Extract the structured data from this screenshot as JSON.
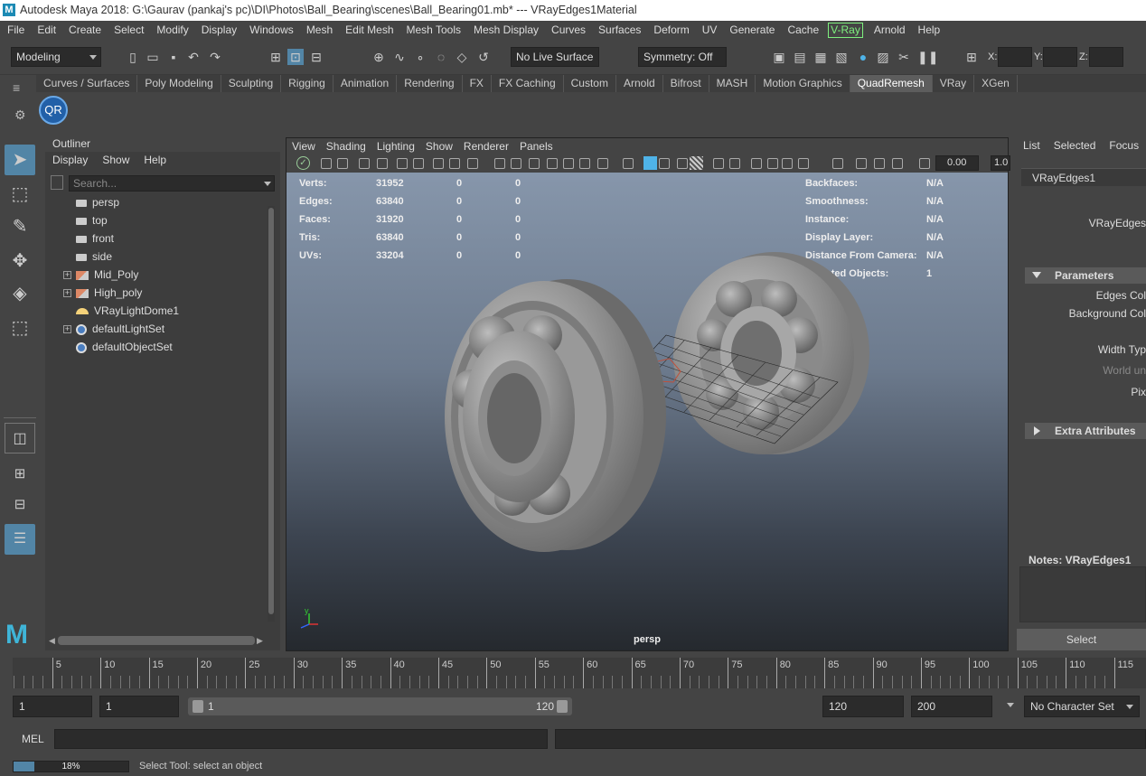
{
  "window": {
    "title": "Autodesk Maya 2018: G:\\Gaurav (pankaj's pc)\\DI\\Photos\\Ball_Bearing\\scenes\\Ball_Bearing01.mb*   ---   VRayEdges1Material",
    "logo": "M"
  },
  "menubar": [
    "File",
    "Edit",
    "Create",
    "Select",
    "Modify",
    "Display",
    "Windows",
    "Mesh",
    "Edit Mesh",
    "Mesh Tools",
    "Mesh Display",
    "Curves",
    "Surfaces",
    "Deform",
    "UV",
    "Generate",
    "Cache",
    "V-Ray",
    "Arnold",
    "Help"
  ],
  "toolbar": {
    "mode": "Modeling",
    "live_surface": "No Live Surface",
    "symmetry": "Symmetry: Off",
    "x_label": "X:",
    "y_label": "Y:",
    "z_label": "Z:"
  },
  "shelf_tabs": [
    "Curves / Surfaces",
    "Poly Modeling",
    "Sculpting",
    "Rigging",
    "Animation",
    "Rendering",
    "FX",
    "FX Caching",
    "Custom",
    "Arnold",
    "Bifrost",
    "MASH",
    "Motion Graphics",
    "QuadRemesh",
    "VRay",
    "XGen"
  ],
  "shelf_active": "QuadRemesh",
  "shelf_button": "QR",
  "outliner": {
    "title": "Outliner",
    "menu": [
      "Display",
      "Show",
      "Help"
    ],
    "search_placeholder": "Search...",
    "items": [
      {
        "label": "persp",
        "icon": "camera-icon",
        "expandable": false
      },
      {
        "label": "top",
        "icon": "camera-icon",
        "expandable": false
      },
      {
        "label": "front",
        "icon": "camera-icon",
        "expandable": false
      },
      {
        "label": "side",
        "icon": "camera-icon",
        "expandable": false
      },
      {
        "label": "Mid_Poly",
        "icon": "group-icon",
        "expandable": true
      },
      {
        "label": "High_poly",
        "icon": "group-icon",
        "expandable": true
      },
      {
        "label": "VRayLightDome1",
        "icon": "dome-light-icon",
        "expandable": false
      },
      {
        "label": "defaultLightSet",
        "icon": "set-icon",
        "expandable": true
      },
      {
        "label": "defaultObjectSet",
        "icon": "set-icon",
        "expandable": false
      }
    ]
  },
  "viewport": {
    "menu": [
      "View",
      "Shading",
      "Lighting",
      "Show",
      "Renderer",
      "Panels"
    ],
    "field1": "0.00",
    "field2": "1.0",
    "camera_label": "persp",
    "axis_y": "y",
    "hud_left": [
      {
        "label": "Verts:",
        "v1": "31952",
        "v2": "0",
        "v3": "0"
      },
      {
        "label": "Edges:",
        "v1": "63840",
        "v2": "0",
        "v3": "0"
      },
      {
        "label": "Faces:",
        "v1": "31920",
        "v2": "0",
        "v3": "0"
      },
      {
        "label": "Tris:",
        "v1": "63840",
        "v2": "0",
        "v3": "0"
      },
      {
        "label": "UVs:",
        "v1": "33204",
        "v2": "0",
        "v3": "0"
      }
    ],
    "hud_right": [
      {
        "label": "Backfaces:",
        "value": "N/A"
      },
      {
        "label": "Smoothness:",
        "value": "N/A"
      },
      {
        "label": "Instance:",
        "value": "N/A"
      },
      {
        "label": "Display Layer:",
        "value": "N/A"
      },
      {
        "label": "Distance From Camera:",
        "value": "N/A"
      },
      {
        "label": "Selected Objects:",
        "value": "1"
      }
    ]
  },
  "attr_editor": {
    "tabs": [
      "List",
      "Selected",
      "Focus"
    ],
    "node_tab": "VRayEdges1",
    "node_label": "VRayEdges",
    "parameters": "Parameters",
    "edges_color": "Edges Col",
    "bg_color": "Background Col",
    "width_type": "Width Typ",
    "world_units": "World un",
    "pixels": "Pix",
    "extra": "Extra Attributes",
    "notes": "Notes:  VRayEdges1",
    "select_button": "Select"
  },
  "timeline": {
    "ticks": [
      "5",
      "10",
      "15",
      "20",
      "25",
      "30",
      "35",
      "40",
      "45",
      "50",
      "55",
      "60",
      "65",
      "70",
      "75",
      "80",
      "85",
      "90",
      "95",
      "100",
      "105",
      "110",
      "115"
    ]
  },
  "range": {
    "start": "1",
    "current": "1",
    "slider_start": "1",
    "slider_end": "120",
    "end": "120",
    "anim_end": "200",
    "char_set": "No Character Set"
  },
  "command": {
    "label": "MEL"
  },
  "status": {
    "progress_text": "18%",
    "progress": 0.18,
    "message": "Select Tool: select an object"
  },
  "colors": {
    "selected_tool": "#5285a6",
    "vray_green": "#7ef07e",
    "qr_blue": "#2260a8"
  }
}
